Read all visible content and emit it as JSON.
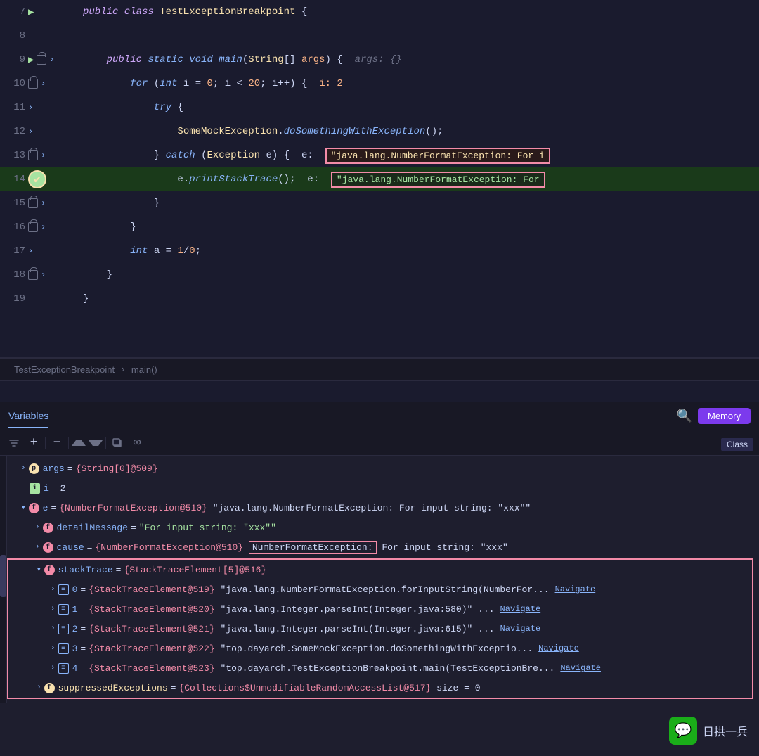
{
  "editor": {
    "lines": [
      {
        "num": 7,
        "indent": 0,
        "content_html": "<span class='kw'>public</span> <span class='kw'>class</span> <span class='cls'>TestExceptionBreakpoint</span> <span class='op'>{</span>",
        "gutter": "arrow-green",
        "bg": "normal"
      },
      {
        "num": 8,
        "indent": 0,
        "content_html": "",
        "gutter": "none",
        "bg": "normal"
      },
      {
        "num": 9,
        "indent": 1,
        "content_html": "<span class='kw'>public</span> <span class='kw2'>static</span> <span class='kw2'>void</span> <span class='fn'>main</span><span class='op'>(</span><span class='cls'>String</span><span class='op'>[]</span> <span class='param'>args</span><span class='op'>)</span> <span class='op'>{</span>  <span class='hint'>args: {}</span>",
        "gutter": "arrow-blue-lock",
        "bg": "normal"
      },
      {
        "num": 10,
        "indent": 2,
        "content_html": "<span class='kw2'>for</span> <span class='op'>(</span><span class='kw2'>int</span> <span class='var'>i</span> <span class='op'>=</span> <span class='num'>0</span><span class='op'>;</span> <span class='var'>i</span> <span class='op'>&lt;</span> <span class='num'>20</span><span class='op'>;</span> <span class='var'>i</span><span class='op'>++)</span> <span class='op'>{</span>  <span class='inline-val'>i: 2</span>",
        "gutter": "lock",
        "bg": "normal"
      },
      {
        "num": 11,
        "indent": 3,
        "content_html": "<span class='kw2'>try</span> <span class='op'>{</span>",
        "gutter": "none",
        "bg": "normal"
      },
      {
        "num": 12,
        "indent": 4,
        "content_html": "<span class='cls'>SomeMockException</span><span class='op'>.</span><span class='fn'>doSomethingWithException</span><span class='op'>();</span>",
        "gutter": "none",
        "bg": "normal"
      },
      {
        "num": 13,
        "indent": 3,
        "content_html": "<span class='op'>}</span> <span class='kw2'>catch</span> <span class='op'>(</span><span class='cls'>Exception</span> <span class='var'>e</span><span class='op'>)</span> <span class='op'>{</span>  <span class='var'>e:</span> <span class='exception-inline'>&quot;java.lang.NumberFormatException: For i</span>",
        "gutter": "lock",
        "bg": "normal",
        "exception": true
      },
      {
        "num": 14,
        "indent": 4,
        "content_html": "<span class='var'>e</span><span class='op'>.</span><span class='fn'>printStackTrace</span><span class='op'>();</span>  <span class='var'>e:</span>",
        "gutter": "breakpoint-active",
        "bg": "highlighted",
        "exception2": true
      },
      {
        "num": 15,
        "indent": 3,
        "content_html": "<span class='op'>}</span>",
        "gutter": "lock",
        "bg": "normal"
      },
      {
        "num": 16,
        "indent": 2,
        "content_html": "<span class='op'>}</span>",
        "gutter": "lock",
        "bg": "normal"
      },
      {
        "num": 17,
        "indent": 2,
        "content_html": "<span class='kw2'>int</span> <span class='var'>a</span> <span class='op'>=</span> <span class='num'>1</span><span class='op'>/</span><span class='num'>0</span><span class='op'>;</span>",
        "gutter": "arrow",
        "bg": "normal"
      },
      {
        "num": 18,
        "indent": 1,
        "content_html": "<span class='op'>}</span>",
        "gutter": "lock",
        "bg": "normal"
      },
      {
        "num": 19,
        "indent": 0,
        "content_html": "<span class='op'>}</span>",
        "gutter": "none",
        "bg": "normal"
      }
    ]
  },
  "breadcrumb": {
    "class": "TestExceptionBreakpoint",
    "method": "main()",
    "separator": "›"
  },
  "debug": {
    "variables_tab": "Variables",
    "memory_btn": "Memory",
    "class_label": "Class",
    "variables": [
      {
        "id": "args",
        "indent": 0,
        "badge": "p",
        "name": "args",
        "type": "{String[0]@509}",
        "value": ""
      },
      {
        "id": "i",
        "indent": 0,
        "badge": "i",
        "name": "i",
        "type": "",
        "value": "= 2"
      },
      {
        "id": "e",
        "indent": 0,
        "badge": "f",
        "name": "e",
        "expanded": true,
        "type": "{NumberFormatException@510}",
        "value": "\"java.lang.NumberFormatException: For input string: \\\"xxx\\\"\""
      },
      {
        "id": "detailMessage",
        "indent": 1,
        "badge": "f",
        "name": "detailMessage",
        "type": "",
        "value": "= \"For input string: \\\"xxx\\\"\""
      },
      {
        "id": "cause",
        "indent": 1,
        "badge": "f",
        "name": "cause",
        "type": "{NumberFormatException@510}",
        "value": "\"java.lang.NumberFormatException: For input string: \\\"xxx\\\"\"",
        "highlight": true
      },
      {
        "id": "stackTrace",
        "indent": 1,
        "badge": "f",
        "name": "stackTrace",
        "expanded": true,
        "type": "{StackTraceElement[5]@516}",
        "value": "",
        "in_red_box": true
      },
      {
        "id": "st0",
        "indent": 2,
        "badge": "list",
        "name": "0",
        "type": "{StackTraceElement@519}",
        "value": "\"java.lang.NumberFormatException.forInputString(NumberFor...\"",
        "navigate": "Navigate",
        "in_red_box": true
      },
      {
        "id": "st1",
        "indent": 2,
        "badge": "list",
        "name": "1",
        "type": "{StackTraceElement@520}",
        "value": "\"java.lang.Integer.parseInt(Integer.java:580)\" ...",
        "navigate": "Navigate",
        "in_red_box": true
      },
      {
        "id": "st2",
        "indent": 2,
        "badge": "list",
        "name": "2",
        "type": "{StackTraceElement@521}",
        "value": "\"java.lang.Integer.parseInt(Integer.java:615)\" ...",
        "navigate": "Navigate",
        "in_red_box": true
      },
      {
        "id": "st3",
        "indent": 2,
        "badge": "list",
        "name": "3",
        "type": "{StackTraceElement@522}",
        "value": "\"top.dayarch.SomeMockException.doSomethingWithExceptio...\"",
        "navigate": "Navigate",
        "in_red_box": true
      },
      {
        "id": "st4",
        "indent": 2,
        "badge": "list",
        "name": "4",
        "type": "{StackTraceElement@523}",
        "value": "\"top.dayarch.TestExceptionBreakpoint.main(TestExceptionBre...\"",
        "navigate": "Navigate",
        "in_red_box": true
      },
      {
        "id": "suppressedExceptions",
        "indent": 1,
        "badge": "f",
        "name": "suppressedExceptions",
        "type": "{Collections$UnmodifiableRandomAccessList@517}",
        "value": "size = 0",
        "in_red_box": true
      }
    ]
  },
  "watermark": {
    "text": "日拱一兵"
  }
}
